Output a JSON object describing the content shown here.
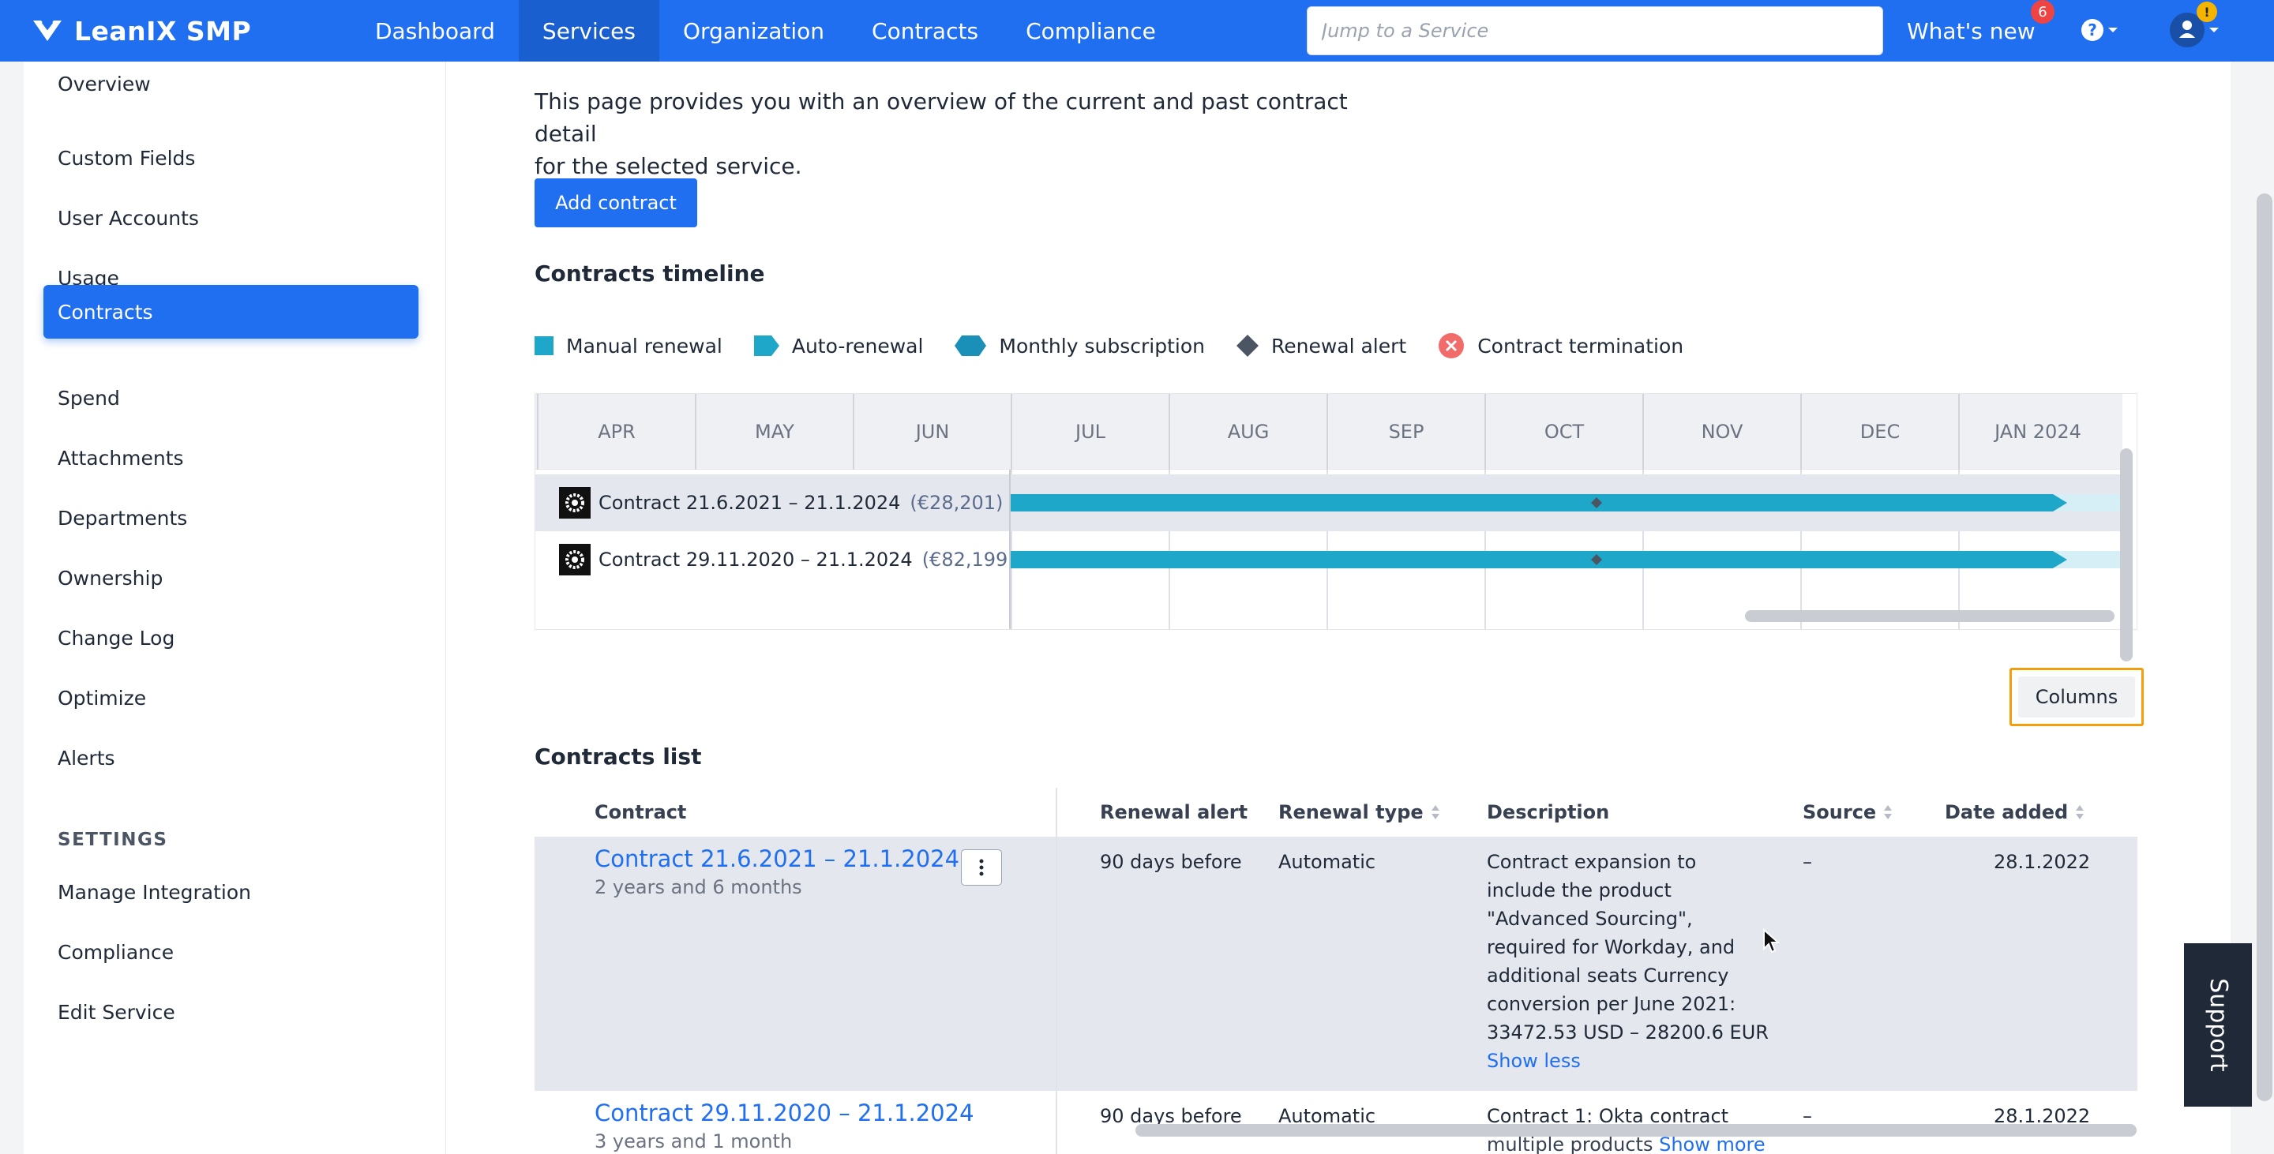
{
  "app": {
    "name": "LeanIX SMP"
  },
  "nav": {
    "items": [
      "Dashboard",
      "Services",
      "Organization",
      "Contracts",
      "Compliance"
    ],
    "active": "Services"
  },
  "search": {
    "placeholder": "Jump to a Service"
  },
  "header": {
    "whats_new": "What's new",
    "notification_count": "6",
    "user_alert": "!"
  },
  "sidebar": {
    "items": [
      "Overview",
      "Custom Fields",
      "User Accounts",
      "Usage",
      "Contracts",
      "Spend",
      "Attachments",
      "Departments",
      "Ownership",
      "Change Log",
      "Optimize",
      "Alerts"
    ],
    "active": "Contracts",
    "settings_heading": "SETTINGS",
    "settings_items": [
      "Manage Integration",
      "Compliance",
      "Edit Service"
    ]
  },
  "main": {
    "intro_line1": "This page provides you with an overview of the current and past contract detail",
    "intro_line2": "for the selected service.",
    "add_contract_label": "Add contract",
    "timeline_heading": "Contracts timeline",
    "legend": [
      "Manual renewal",
      "Auto-renewal",
      "Monthly subscription",
      "Renewal alert",
      "Contract termination"
    ],
    "months": [
      "APR",
      "MAY",
      "JUN",
      "JUL",
      "AUG",
      "SEP",
      "OCT",
      "NOV",
      "DEC",
      "JAN 2024"
    ],
    "timeline_rows": [
      {
        "label": "Contract 21.6.2021 – 21.1.2024",
        "cost": "(€28,201)"
      },
      {
        "label": "Contract 29.11.2020 – 21.1.2024",
        "cost": "(€82,199)"
      }
    ],
    "list_heading": "Contracts list",
    "columns_label": "Columns",
    "table": {
      "headers": [
        "Contract",
        "Renewal alert",
        "Renewal type",
        "Description",
        "Source",
        "Date added"
      ],
      "rows": [
        {
          "contract": "Contract 21.6.2021 – 21.1.2024",
          "duration": "2 years and 6 months",
          "renewal_alert": "90 days before",
          "renewal_type": "Automatic",
          "description_lines": [
            "Contract expansion to",
            "include the product",
            "\"Advanced Sourcing\",",
            "required for Workday, and",
            "additional seats Currency",
            "conversion per June 2021:",
            "33472.53 USD – 28200.6 EUR"
          ],
          "toggle": "Show less",
          "source": "–",
          "date_added": "28.1.2022"
        },
        {
          "contract": "Contract 29.11.2020 – 21.1.2024",
          "duration": "3 years and 1 month",
          "renewal_alert": "90 days before",
          "renewal_type": "Automatic",
          "description_lines": [
            "Contract 1: Okta contract",
            "multiple products"
          ],
          "toggle": "Show more",
          "source": "–",
          "date_added": "28.1.2022"
        }
      ]
    }
  },
  "support_label": "Support",
  "colors": {
    "primary": "#1f6ff0",
    "timeline_bar": "#1ea7c9",
    "highlight": "#f59e0b"
  }
}
